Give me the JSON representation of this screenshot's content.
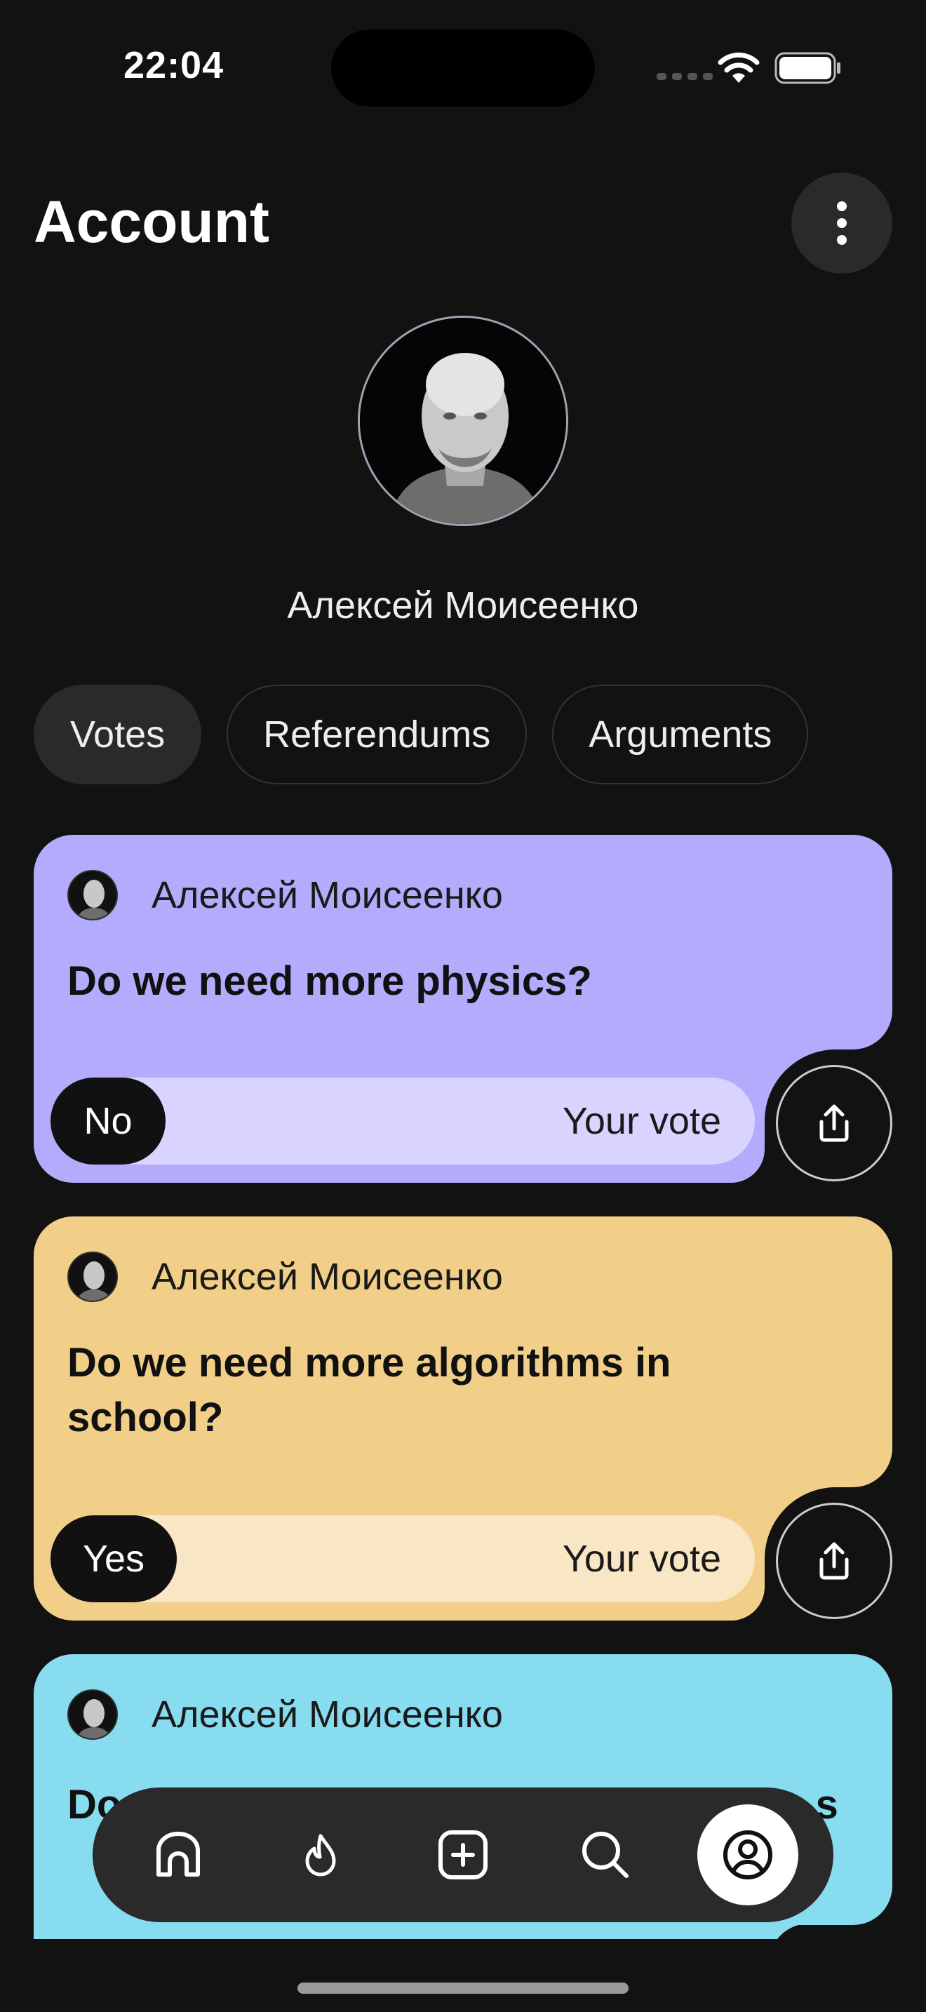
{
  "status_bar": {
    "time": "22:04"
  },
  "header": {
    "title": "Account"
  },
  "profile": {
    "name": "Алексей Моисеенко"
  },
  "tabs": [
    {
      "label": "Votes",
      "active": true
    },
    {
      "label": "Referendums",
      "active": false
    },
    {
      "label": "Arguments",
      "active": false
    }
  ],
  "cards": [
    {
      "author": "Алексей Моисеенко",
      "question": "Do we need more physics?",
      "vote": "No",
      "vote_label": "Your vote",
      "color": "#b3abfc",
      "bar_color": "#d9d4ff"
    },
    {
      "author": "Алексей Моисеенко",
      "question": "Do we need more algorithms in school?",
      "vote": "Yes",
      "vote_label": "Your vote",
      "color": "#f2cf89",
      "bar_color": "#f8e6c4"
    },
    {
      "author": "Алексей Моисеенко",
      "question": "Do we need to spend higher on this to s",
      "color": "#87dcf0"
    }
  ],
  "tabbar": {
    "items": [
      {
        "icon": "home-icon"
      },
      {
        "icon": "flame-icon"
      },
      {
        "icon": "add-square-icon"
      },
      {
        "icon": "search-icon"
      },
      {
        "icon": "profile-icon",
        "active": true
      }
    ]
  }
}
